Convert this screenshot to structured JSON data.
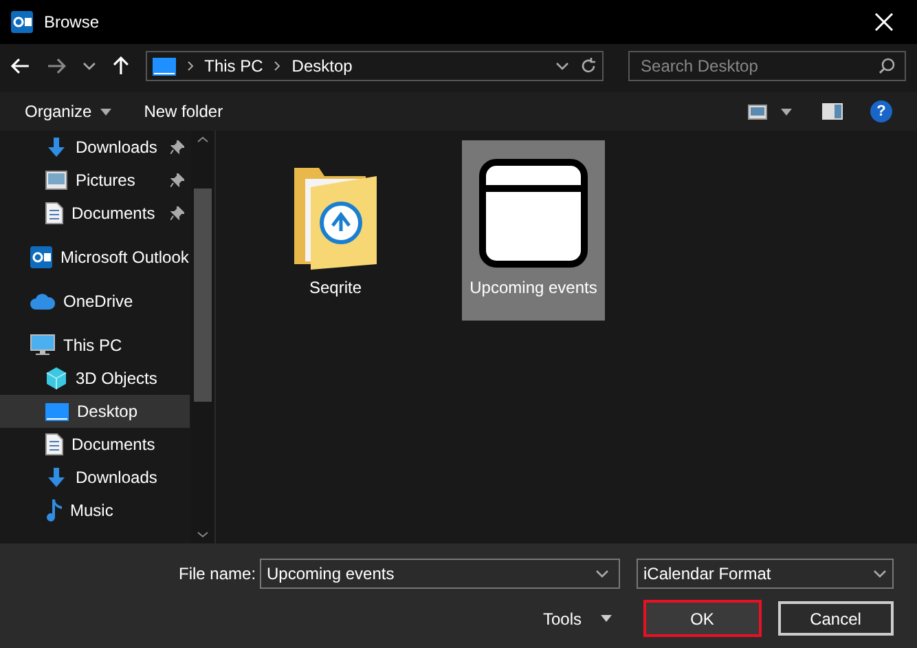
{
  "window": {
    "title": "Browse"
  },
  "address_bar": {
    "path": [
      "This PC",
      "Desktop"
    ]
  },
  "search": {
    "placeholder": "Search Desktop"
  },
  "toolbar": {
    "organize": "Organize",
    "new_folder": "New folder",
    "help": "?"
  },
  "sidebar": {
    "quick_access": [
      {
        "label": "Downloads",
        "kind": "downloads",
        "pinned": true
      },
      {
        "label": "Pictures",
        "kind": "pictures",
        "pinned": true
      },
      {
        "label": "Documents",
        "kind": "documents",
        "pinned": true
      }
    ],
    "items": [
      {
        "label": "Microsoft Outlook",
        "kind": "outlook",
        "selected": false
      },
      {
        "label": "OneDrive",
        "kind": "cloud",
        "selected": false
      },
      {
        "label": "This PC",
        "kind": "pc",
        "selected": false,
        "children": [
          {
            "label": "3D Objects",
            "kind": "cube",
            "selected": false
          },
          {
            "label": "Desktop",
            "kind": "desktop",
            "selected": true
          },
          {
            "label": "Documents",
            "kind": "documents",
            "selected": false
          },
          {
            "label": "Downloads",
            "kind": "downloads",
            "selected": false
          },
          {
            "label": "Music",
            "kind": "music",
            "selected": false
          }
        ]
      }
    ]
  },
  "files": [
    {
      "name": "Seqrite",
      "kind": "folder",
      "selected": false
    },
    {
      "name": "Upcoming events",
      "kind": "calendar",
      "selected": true
    }
  ],
  "footer": {
    "file_name_label": "File name:",
    "file_name": "Upcoming events",
    "file_type": "iCalendar Format",
    "tools": "Tools",
    "ok": "OK",
    "cancel": "Cancel"
  }
}
